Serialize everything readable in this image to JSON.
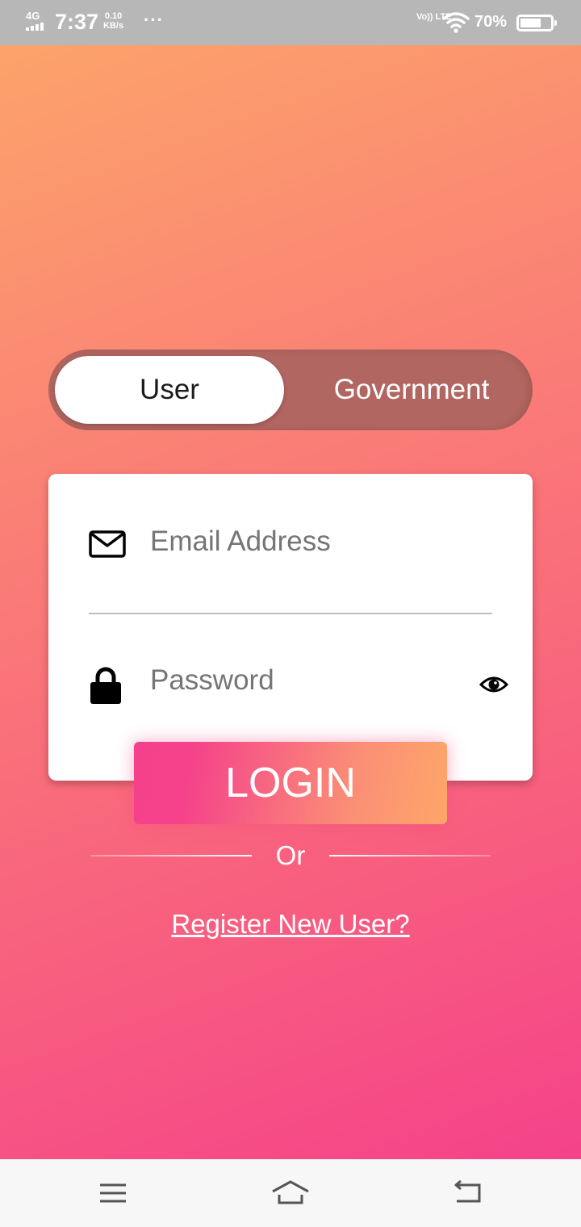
{
  "status_bar": {
    "network": "4G",
    "time": "7:37",
    "speed_value": "0.10",
    "speed_unit": "KB/s",
    "more": "···",
    "volte": "Vo)) LTE",
    "battery_percent": "70%",
    "battery_level": 0.7
  },
  "toggle": {
    "options": [
      "User",
      "Government"
    ],
    "selected": "User"
  },
  "form": {
    "email_placeholder": "Email Address",
    "password_placeholder": "Password"
  },
  "login_label": "LOGIN",
  "divider_label": "Or",
  "register_link": "Register New User?",
  "icons": {
    "email": "envelope-icon",
    "password": "lock-icon",
    "visibility": "eye-icon",
    "nav_menu": "menu-icon",
    "nav_home": "home-icon",
    "nav_back": "back-icon"
  },
  "colors": {
    "gradient_top": "#fca36a",
    "gradient_bottom": "#f5428a",
    "toggle_track": "#b16661",
    "login_start": "#f5418b",
    "login_end": "#fda669"
  }
}
